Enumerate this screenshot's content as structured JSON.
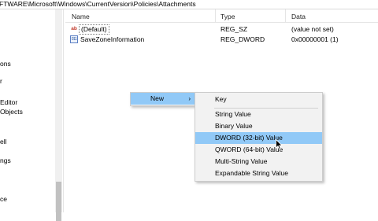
{
  "address": {
    "path": "FTWARE\\Microsoft\\Windows\\CurrentVersion\\Policies\\Attachments"
  },
  "tree": {
    "items": [
      "ons",
      "",
      "Editor",
      "Objects",
      "ell",
      "ngs",
      "",
      "ce"
    ]
  },
  "list": {
    "columns": {
      "name": "Name",
      "type": "Type",
      "data": "Data"
    },
    "rows": [
      {
        "icon": "string-value-icon",
        "name": "(Default)",
        "type": "REG_SZ",
        "data": "(value not set)"
      },
      {
        "icon": "dword-value-icon",
        "name": "SaveZoneInformation",
        "type": "REG_DWORD",
        "data": "0x00000001 (1)"
      }
    ]
  },
  "context_menu": {
    "new_label": "New",
    "arrow": "›"
  },
  "submenu": {
    "key_label": "Key",
    "items": [
      "String Value",
      "Binary Value",
      "DWORD (32-bit) Value",
      "QWORD (64-bit) Value",
      "Multi-String Value",
      "Expandable String Value"
    ],
    "highlighted_index": 2
  },
  "icons": {
    "string_icon_glyph": "ab",
    "binary_icon_glyph": "011"
  },
  "colors": {
    "highlight": "#91c9f7",
    "menu_bg": "#f2f2f2"
  }
}
